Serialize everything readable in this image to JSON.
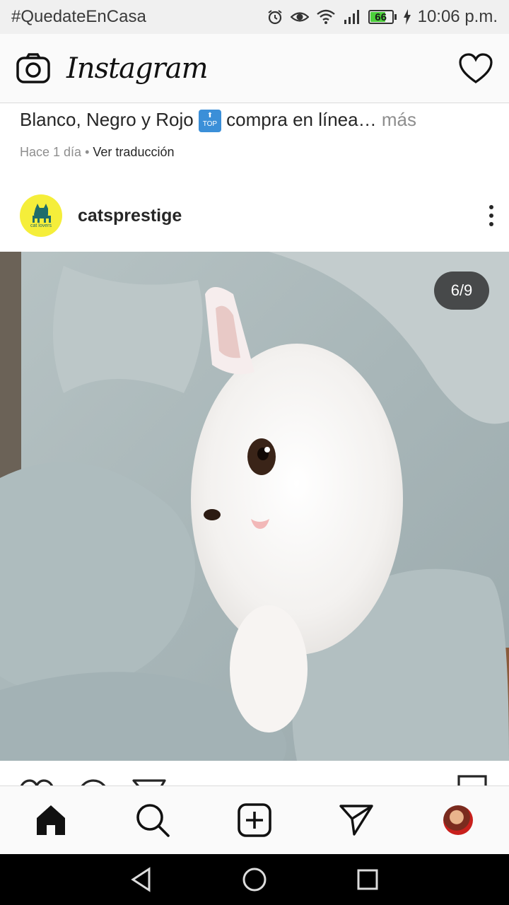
{
  "status_bar": {
    "left_text": "#QuedateEnCasa",
    "battery_level": "66",
    "time": "10:06 p.m."
  },
  "header": {
    "app_title": "Instagram"
  },
  "caption": {
    "text": "Blanco, Negro y Rojo",
    "emoji_label": "TOP",
    "text_after": "compra en línea",
    "ellipsis": "…",
    "more_label": "más",
    "time_ago": "Hace 1 día",
    "separator": "•",
    "translate_label": "Ver traducción"
  },
  "post": {
    "username": "catsprestige",
    "avatar_text": "cat lovers",
    "image_counter": "6/9"
  },
  "nav": {
    "items": [
      "home-icon",
      "search-icon",
      "new-post-icon",
      "direct-icon",
      "profile-avatar"
    ]
  },
  "colors": {
    "header_bg": "#fafafa",
    "status_bg": "#f0f0f0",
    "avatar_bg": "#f5ee3a",
    "battery_fill": "#4ccf3b",
    "text": "#262626",
    "muted": "#8e8e8e"
  }
}
